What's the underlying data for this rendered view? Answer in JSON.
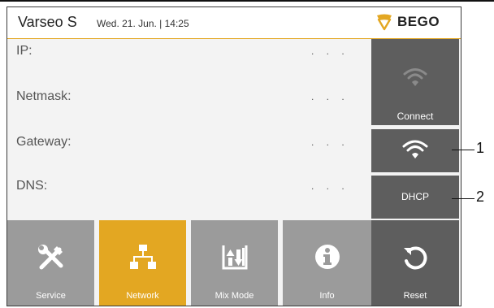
{
  "header": {
    "app_name": "Varseo S",
    "datetime": "Wed. 21. Jun. | 14:25",
    "brand": "BEGO",
    "brand_color": "#e3a722"
  },
  "network": {
    "fields": [
      {
        "label": "IP:",
        "value": ". . ."
      },
      {
        "label": "Netmask:",
        "value": ". . ."
      },
      {
        "label": "Gateway:",
        "value": ". . ."
      },
      {
        "label": "DNS:",
        "value": ". . ."
      }
    ]
  },
  "side": {
    "connect_label": "Connect",
    "wifi_icon": "wifi-icon",
    "dhcp_label": "DHCP",
    "reset_label": "Reset"
  },
  "tabs": [
    {
      "label": "Service",
      "icon": "tools-icon",
      "active": false
    },
    {
      "label": "Network",
      "icon": "network-icon",
      "active": true
    },
    {
      "label": "Mix Mode",
      "icon": "mix-mode-icon",
      "active": false
    },
    {
      "label": "Info",
      "icon": "info-icon",
      "active": false
    }
  ],
  "callouts": [
    "1",
    "2"
  ]
}
